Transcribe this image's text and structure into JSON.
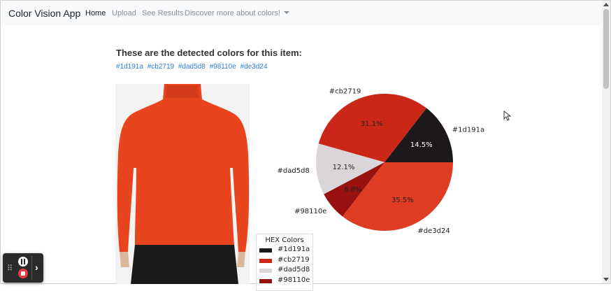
{
  "navbar": {
    "brand": "Color Vision App",
    "links": [
      "Home",
      "Upload",
      "See Results",
      "Discover more about colors!"
    ]
  },
  "main": {
    "heading": "These are the detected colors for this item:",
    "hex_links": [
      "#1d191a",
      "#cb2719",
      "#dad5d8",
      "#98110e",
      "#de3d24"
    ]
  },
  "legend": {
    "title": "HEX Colors",
    "entries": [
      "#1d191a",
      "#cb2719",
      "#dad5d8",
      "#98110e"
    ]
  },
  "colors": {
    "navbar_bg": "#f8f9fa",
    "link_blue": "#2f7fe0",
    "sweater": "#e8451f"
  },
  "chart_data": {
    "type": "pie",
    "labels": [
      "#1d191a",
      "#cb2719",
      "#dad5d8",
      "#98110e",
      "#de3d24"
    ],
    "values": [
      14.5,
      31.1,
      12.1,
      6.8,
      35.5
    ],
    "value_labels": [
      "14.5%",
      "31.1%",
      "12.1%",
      "6.8%",
      "35.5%"
    ],
    "colors": [
      "#1d191a",
      "#cb2719",
      "#dad5d8",
      "#98110e",
      "#de3d24"
    ],
    "start_angle": 0,
    "direction": "counterclockwise"
  }
}
